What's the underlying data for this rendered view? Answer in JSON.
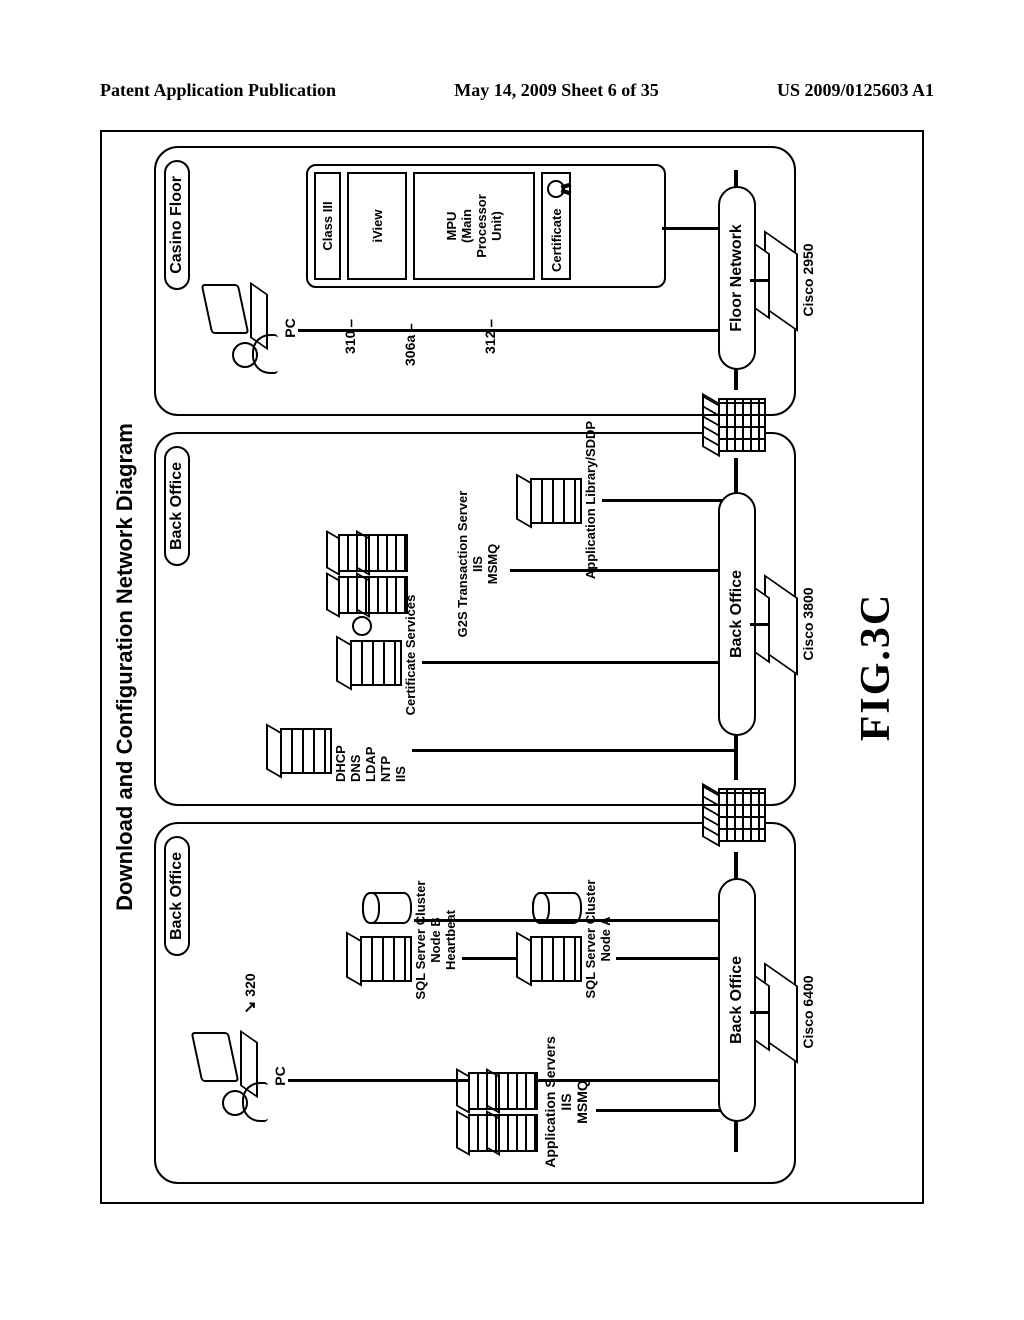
{
  "header": {
    "left": "Patent Application Publication",
    "mid": "May 14, 2009  Sheet 6 of 35",
    "right": "US 2009/0125603 A1"
  },
  "title": "Download and Configuration Network Diagram",
  "zones": {
    "bo1": "Back Office",
    "bo2": "Back Office",
    "cf": "Casino Floor"
  },
  "networks": {
    "bo1": "Back Office",
    "bo2": "Back Office",
    "floor": "Floor Network"
  },
  "switches": {
    "bo1": "Cisco 6400",
    "bo2": "Cisco 3800",
    "floor": "Cisco 2950"
  },
  "nodes": {
    "appservers": "Application Servers\nIIS\nMSMQ",
    "sqlA": "SQL Server Cluster\nNode A",
    "sqlB": "SQL Server Cluster\nNode B\nHeartbeat",
    "infra": "DHCP\nDNS\nLDAP\nNTP\nIIS",
    "certsvc": "Certificate Services",
    "g2s": "G2S Transaction Server\nIIS\nMSMQ",
    "applib": "Application Library/SDDP",
    "pc1": "PC",
    "pc2": "PC",
    "ref320": "320",
    "ref310": "310",
    "ref306a": "306a",
    "ref312": "312",
    "egm_class": "Class III",
    "egm_iview": "iView",
    "egm_mpu": "MPU\n(Main\nProcessor\nUnit)",
    "egm_cert": "Certificate"
  },
  "figure": "FIG.3C"
}
